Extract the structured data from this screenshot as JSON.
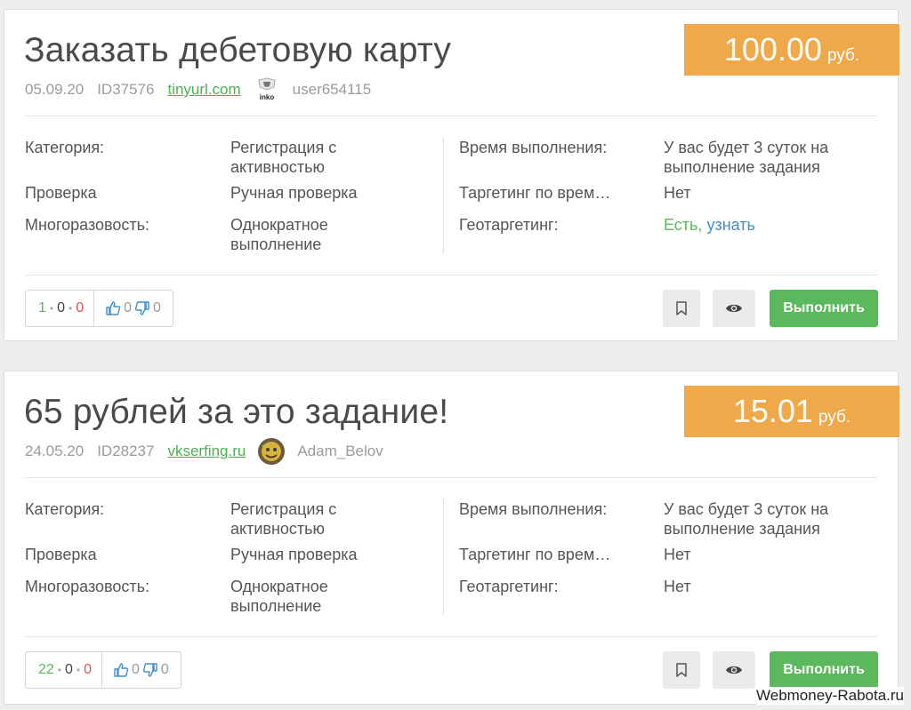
{
  "tasks": [
    {
      "title": "Заказать дебетовую карту",
      "price": "100.00",
      "currency": "руб.",
      "date": "05.09.20",
      "id": "ID37576",
      "link": "tinyurl.com",
      "user": "user654115",
      "avatar_text": "Tinkoff",
      "labels": {
        "category": "Категория:",
        "check": "Проверка",
        "multi": "Многоразовость:",
        "time": "Время выполнения:",
        "time_target": "Таргетинг по врем…",
        "geo": "Геотаргетинг:"
      },
      "category_value": "Регистрация с активностью",
      "check_value": "Ручная проверка",
      "multi_value": "Однократное выполнение",
      "time_value": "У вас будет 3 суток на выполнение задания",
      "time_target_value": "Нет",
      "geo_value": "Есть,",
      "geo_link": "узнать",
      "stats": {
        "done": "1",
        "pending": "0",
        "rejected": "0",
        "likes": "0",
        "dislikes": "0"
      },
      "exec_label": "Выполнить"
    },
    {
      "title": "65 рублей за это задание!",
      "price": "15.01",
      "currency": "руб.",
      "date": "24.05.20",
      "id": "ID28237",
      "link": "vkserfing.ru",
      "user": "Adam_Belov",
      "labels": {
        "category": "Категория:",
        "check": "Проверка",
        "multi": "Многоразовость:",
        "time": "Время выполнения:",
        "time_target": "Таргетинг по врем…",
        "geo": "Геотаргетинг:"
      },
      "category_value": "Регистрация с активностью",
      "check_value": "Ручная проверка",
      "multi_value": "Однократное выполнение",
      "time_value": "У вас будет 3 суток на выполнение задания",
      "time_target_value": "Нет",
      "geo_value": "Нет",
      "stats": {
        "done": "22",
        "pending": "0",
        "rejected": "0",
        "likes": "0",
        "dislikes": "0"
      },
      "exec_label": "Выполнить"
    }
  ],
  "icons": {
    "bookmark": "bookmark-icon",
    "eye": "eye-icon",
    "thumb_up": "thumbs-up-icon",
    "thumb_down": "thumbs-down-icon"
  },
  "colors": {
    "price_bg": "#f0a94a",
    "exec_bg": "#5cb85c",
    "link_green": "#4caf50",
    "link_blue": "#3d8fd0"
  },
  "watermark": "Webmoney-Rabota.ru"
}
